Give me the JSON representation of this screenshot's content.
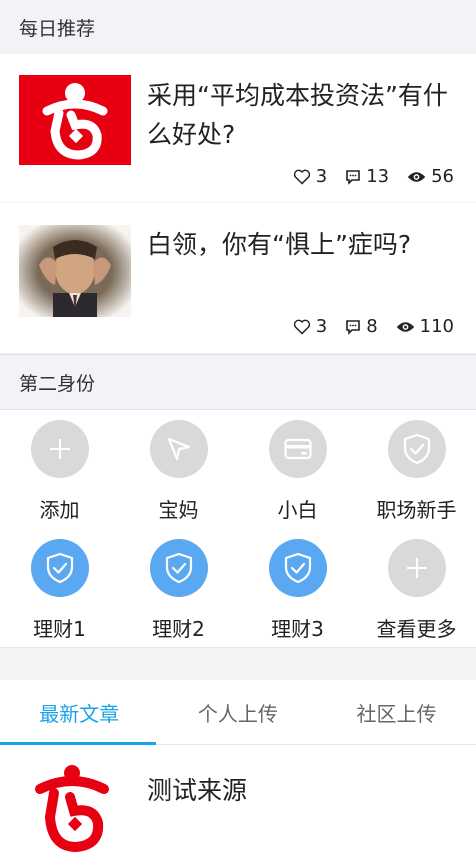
{
  "daily": {
    "header": "每日推荐",
    "articles": [
      {
        "title": "采用“平均成本投资法”有什么好处?",
        "likes": "3",
        "comments": "13",
        "views": "56",
        "thumb_icon": "red-logo-thumbnail"
      },
      {
        "title": "白领，你有“惧上”症吗?",
        "likes": "3",
        "comments": "8",
        "views": "110",
        "thumb_icon": "stressed-man-photo"
      }
    ]
  },
  "identity": {
    "header": "第二身份",
    "items": [
      {
        "label": "添加",
        "icon": "plus-icon",
        "style": "gray"
      },
      {
        "label": "宝妈",
        "icon": "paper-plane-icon",
        "style": "gray"
      },
      {
        "label": "小白",
        "icon": "card-icon",
        "style": "gray"
      },
      {
        "label": "职场新手",
        "icon": "shield-check-icon",
        "style": "gray"
      },
      {
        "label": "理财1",
        "icon": "shield-check-icon",
        "style": "blue"
      },
      {
        "label": "理财2",
        "icon": "shield-check-icon",
        "style": "blue"
      },
      {
        "label": "理财3",
        "icon": "shield-check-icon",
        "style": "blue"
      },
      {
        "label": "查看更多",
        "icon": "plus-icon",
        "style": "gray"
      }
    ]
  },
  "tabs": {
    "items": [
      "最新文章",
      "个人上传",
      "社区上传"
    ],
    "active": "最新文章"
  },
  "latest": {
    "title": "测试来源"
  },
  "colors": {
    "accent": "#1aa3e8",
    "brand_red": "#e60012",
    "shield_blue": "#5aa8f2",
    "icon_gray": "#d9d9d9"
  }
}
